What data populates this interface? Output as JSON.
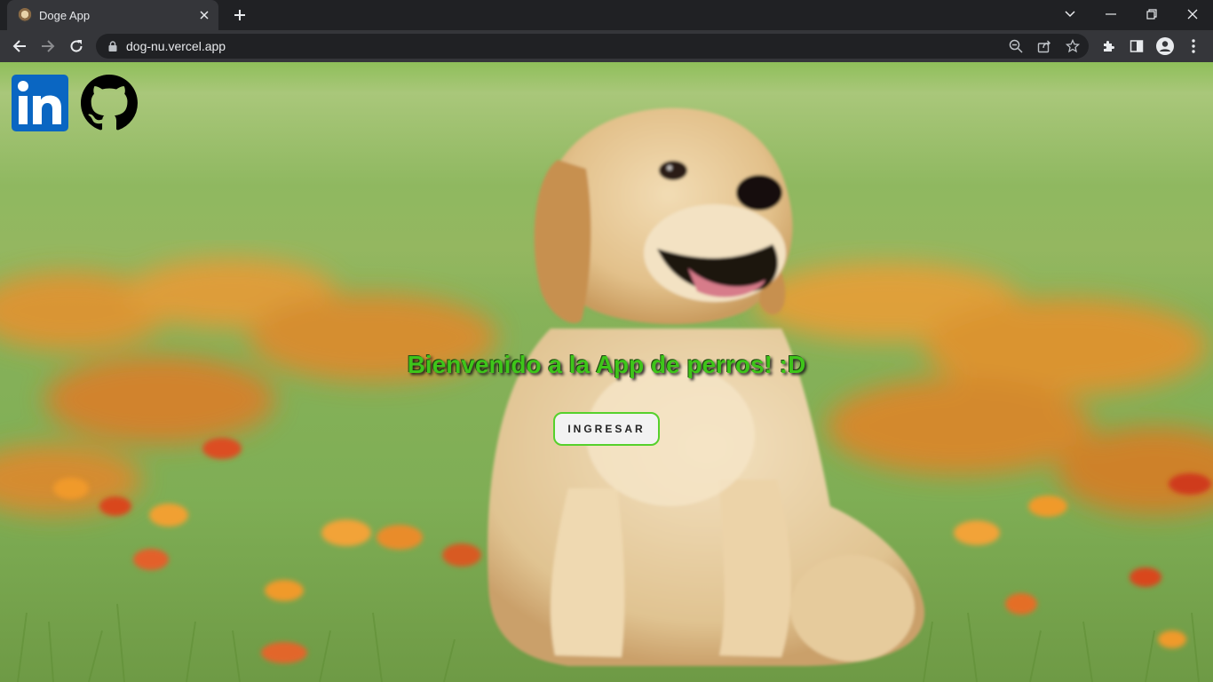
{
  "browser": {
    "tab_title": "Doge App",
    "url": "dog-nu.vercel.app"
  },
  "page": {
    "welcome_text": "Bienvenido a la App de perros! :D",
    "enter_button": "INGRESAR",
    "social": [
      {
        "name": "linkedin",
        "label": "in",
        "color": "#0a66c2"
      },
      {
        "name": "github",
        "color": "#000000"
      }
    ]
  },
  "colors": {
    "welcome": "#3ec51a",
    "button_border": "#56d12c"
  }
}
